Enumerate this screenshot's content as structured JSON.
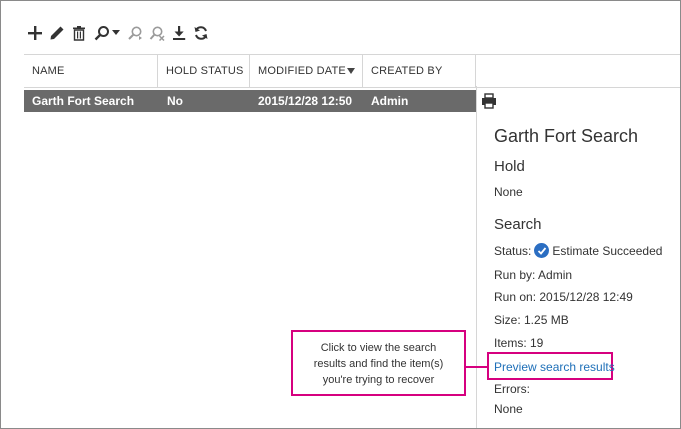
{
  "toolbar": {
    "icons": [
      "add-icon",
      "edit-icon",
      "delete-icon",
      "search-icon",
      "start-search-icon",
      "stop-search-icon",
      "export-icon",
      "refresh-icon"
    ]
  },
  "table": {
    "columns": [
      "NAME",
      "HOLD STATUS",
      "MODIFIED DATE",
      "CREATED BY"
    ],
    "sorted_column": "MODIFIED DATE",
    "rows": [
      {
        "name": "Garth Fort Search",
        "hold_status": "No",
        "modified_date": "2015/12/28 12:50",
        "created_by": "Admin"
      }
    ]
  },
  "details": {
    "title": "Garth Fort Search",
    "hold_heading": "Hold",
    "hold_value": "None",
    "search_heading": "Search",
    "status_label": "Status:",
    "status_value": "Estimate Succeeded",
    "run_by": "Run by: Admin",
    "run_on": "Run on: 2015/12/28 12:49",
    "size": "Size: 1.25 MB",
    "items": "Items: 19",
    "preview_link": "Preview search results",
    "errors_label": "Errors:",
    "errors_value": "None"
  },
  "callout": {
    "lines": [
      "Click to view the search",
      "results and find the item(s)",
      "you're trying to recover"
    ]
  },
  "colors": {
    "selected_row": "#6a6a6a",
    "callout_border": "#d6007f",
    "link": "#1e6fb8",
    "status_icon": "#2b6ec2"
  }
}
